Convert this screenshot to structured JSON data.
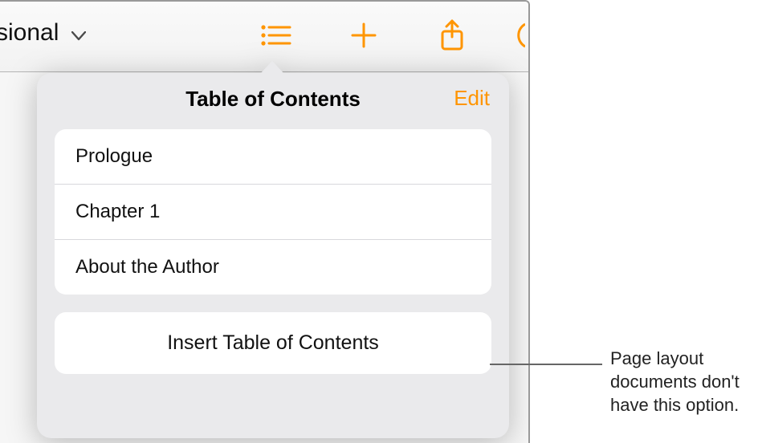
{
  "toolbar": {
    "style_label": "ssional"
  },
  "popover": {
    "title": "Table of Contents",
    "edit_label": "Edit",
    "items": [
      {
        "label": "Prologue"
      },
      {
        "label": "Chapter 1"
      },
      {
        "label": "About the Author"
      }
    ],
    "insert_label": "Insert Table of Contents"
  },
  "callout": {
    "text": "Page layout documents don't have this option."
  }
}
